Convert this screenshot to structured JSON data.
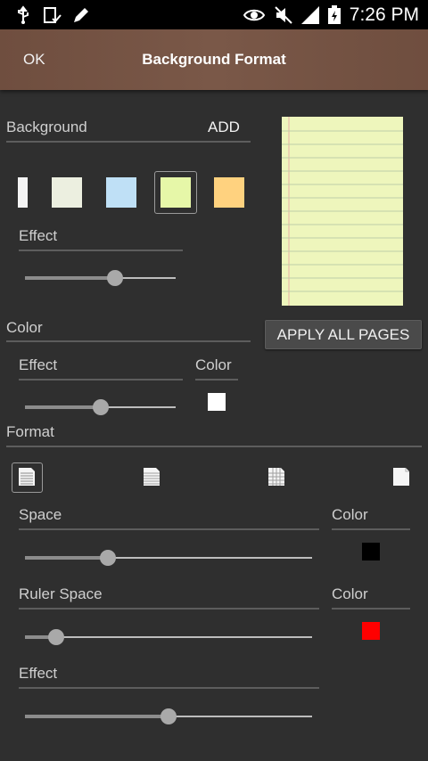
{
  "status_bar": {
    "time": "7:26 PM",
    "icons": [
      "usb-icon",
      "clipboard-check-icon",
      "pencil-icon",
      "eye-icon",
      "mute-icon",
      "signal-icon",
      "battery-charging-icon"
    ]
  },
  "action_bar": {
    "ok_label": "OK",
    "title": "Background Format"
  },
  "background_section": {
    "label": "Background",
    "add_label": "ADD",
    "swatches": [
      {
        "name": "white",
        "color": "#f4f4f4"
      },
      {
        "name": "paper",
        "color": "#ecefe0"
      },
      {
        "name": "blue",
        "color": "#bfe0f6"
      },
      {
        "name": "yellow-green",
        "color": "#e6f7a8",
        "selected": true
      },
      {
        "name": "orange",
        "color": "#ffd27f"
      }
    ],
    "effect_label": "Effect",
    "effect_value": 0.6
  },
  "preview": {
    "apply_all_label": "APPLY ALL PAGES"
  },
  "color_section": {
    "label": "Color",
    "effect_label": "Effect",
    "effect_value": 0.5,
    "color_label": "Color",
    "color_value": "#ffffff"
  },
  "format_section": {
    "label": "Format",
    "formats": [
      "format-lined-icon",
      "format-plain-lines-icon",
      "format-grid-icon",
      "format-blank-icon"
    ],
    "space_label": "Space",
    "space_value": 0.29,
    "space_color_label": "Color",
    "space_color": "#000000",
    "ruler_label": "Ruler Space",
    "ruler_value": 0.11,
    "ruler_color_label": "Color",
    "ruler_color": "#ff0000",
    "effect_label": "Effect",
    "effect_value": 0.5
  }
}
